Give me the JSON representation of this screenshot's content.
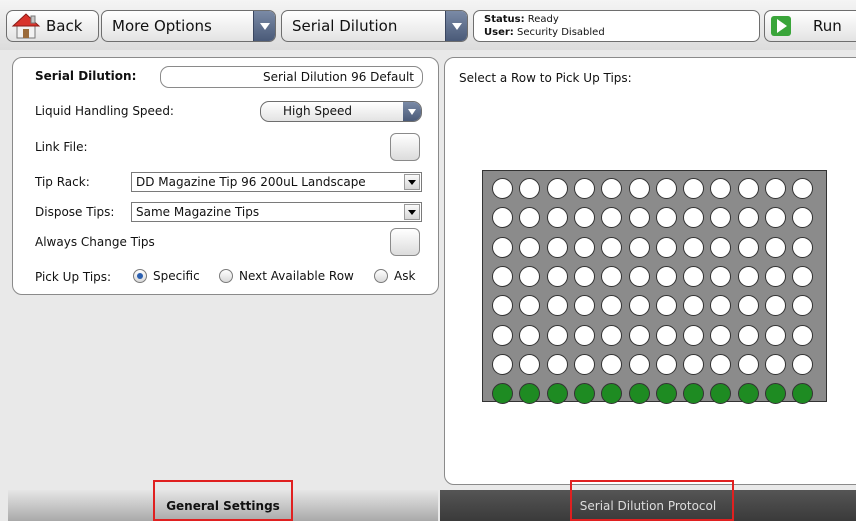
{
  "toolbar": {
    "back_label": "Back",
    "more_options_label": "More Options",
    "serial_dilution_label": "Serial Dilution",
    "status_label": "Status:",
    "status_value": "Ready",
    "user_label": "User:",
    "user_value": "Security Disabled",
    "run_label": "Run"
  },
  "settings": {
    "serial_dilution_label": "Serial Dilution:",
    "serial_dilution_value": "Serial Dilution 96 Default",
    "speed_label": "Liquid Handling Speed:",
    "speed_value": "High Speed",
    "link_file_label": "Link File:",
    "tip_rack_label": "Tip Rack:",
    "tip_rack_value": "DD Magazine Tip 96 200uL Landscape",
    "dispose_label": "Dispose Tips:",
    "dispose_value": "Same Magazine Tips",
    "always_change_label": "Always Change Tips",
    "pickup_label": "Pick Up Tips:",
    "pickup_options": [
      "Specific",
      "Next Available Row",
      "Ask"
    ],
    "pickup_selected": "Specific"
  },
  "plate": {
    "title": "Select a Row to Pick Up Tips:",
    "rows": 8,
    "columns": 12,
    "picked_row": 8,
    "empty_color": "#ffffff",
    "picked_color": "#1e8b22"
  },
  "tabs": {
    "general": "General Settings",
    "protocol": "Serial Dilution Protocol"
  },
  "colors": {
    "highlight": "#e02020",
    "run_green": "#3aa53a"
  },
  "icons": {
    "back": "house-icon",
    "run": "play-icon"
  }
}
